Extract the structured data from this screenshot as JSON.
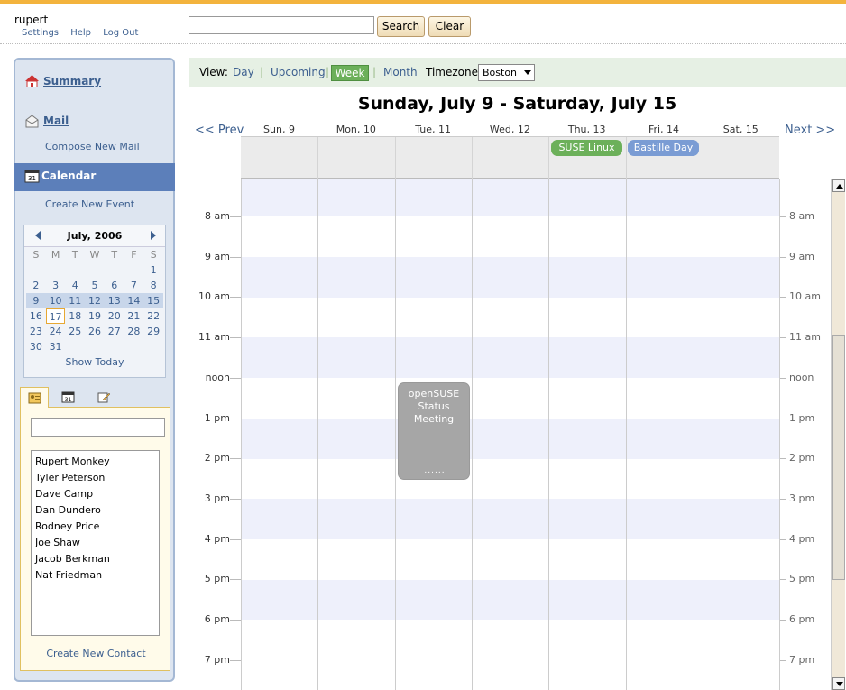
{
  "header": {
    "username": "rupert",
    "links": [
      "Settings",
      "Help",
      "Log Out"
    ],
    "search_placeholder": "",
    "search_label": "Search",
    "clear_label": "Clear"
  },
  "sidebar": {
    "summary": "Summary",
    "mail": "Mail",
    "compose": "Compose New Mail",
    "calendar": "Calendar",
    "create_event": "Create New Event",
    "minical": {
      "title": "July, 2006",
      "dow": [
        "S",
        "M",
        "T",
        "W",
        "T",
        "F",
        "S"
      ],
      "weeks": [
        [
          "",
          "",
          "",
          "",
          "",
          "",
          "1"
        ],
        [
          "2",
          "3",
          "4",
          "5",
          "6",
          "7",
          "8"
        ],
        [
          "9",
          "10",
          "11",
          "12",
          "13",
          "14",
          "15"
        ],
        [
          "16",
          "17",
          "18",
          "19",
          "20",
          "21",
          "22"
        ],
        [
          "23",
          "24",
          "25",
          "26",
          "27",
          "28",
          "29"
        ],
        [
          "30",
          "31",
          "",
          "",
          "",
          "",
          ""
        ]
      ],
      "today": "17",
      "show_today": "Show Today"
    },
    "contacts": [
      "Rupert Monkey",
      "Tyler Peterson",
      "Dave Camp",
      "Dan Dundero",
      "Rodney Price",
      "Joe Shaw",
      "Jacob Berkman",
      "Nat Friedman"
    ],
    "create_contact": "Create New Contact"
  },
  "viewbar": {
    "view_label": "View:",
    "day": "Day",
    "upcoming": "Upcoming",
    "week": "Week",
    "month": "Month",
    "timezone_label": "Timezone:",
    "timezone": "Boston"
  },
  "week": {
    "title": "Sunday, July 9 - Saturday, July 15",
    "prev": "<< Prev",
    "next": "Next >>",
    "days": [
      "Sun, 9",
      "Mon, 10",
      "Tue, 11",
      "Wed, 12",
      "Thu, 13",
      "Fri, 14",
      "Sat, 15"
    ],
    "hours": [
      "8 am",
      "9 am",
      "10 am",
      "11 am",
      "noon",
      "1 pm",
      "2 pm",
      "3 pm",
      "4 pm",
      "5 pm",
      "6 pm",
      "7 pm"
    ],
    "allday_events": [
      {
        "title": "SUSE Linux",
        "day": "Thu, 13",
        "color": "#6cb05a"
      },
      {
        "title": "Bastille Day",
        "day": "Fri, 14",
        "color": "#7a9cd4"
      }
    ],
    "timed_events": [
      {
        "title": "openSUSE Status Meeting",
        "day": "Tue, 11",
        "start": "noon",
        "end": "2:30 pm",
        "dots": "......"
      }
    ]
  },
  "colors": {
    "accent": "#f3b33d",
    "sidebar_bg": "#dde5f0",
    "selected_band": "#5c7fba",
    "week_active": "#6cb05a"
  }
}
